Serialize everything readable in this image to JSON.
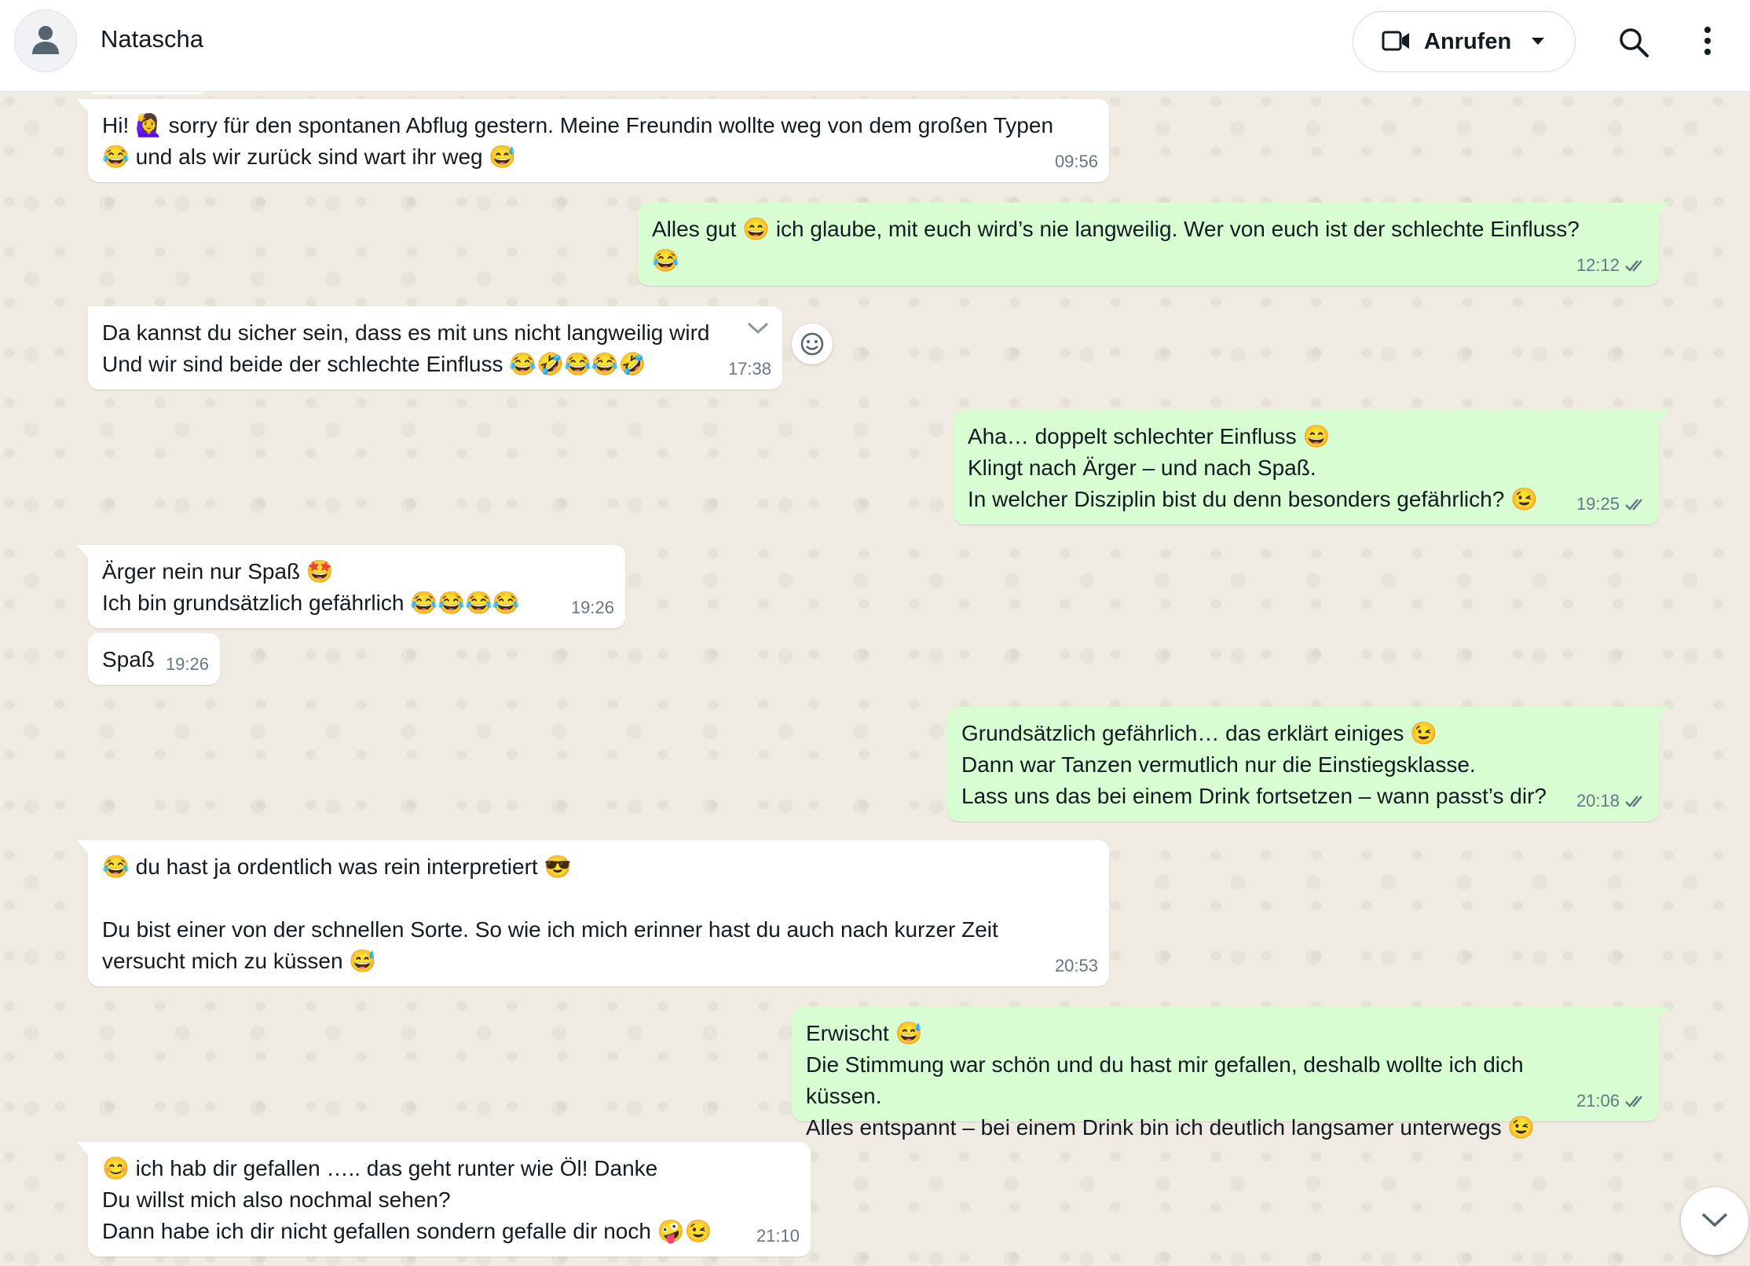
{
  "header": {
    "contact_name": "Natascha",
    "call_label": "Anrufen"
  },
  "messages": [
    {
      "direction": "in",
      "text": "Hi! 🙋‍♀️ sorry für den spontanen Abflug gestern. Meine Freundin wollte weg von dem großen Typen\n😂 und als wir zurück sind wart ihr weg 😅",
      "time": "09:56"
    },
    {
      "direction": "out",
      "text": "Alles gut 😄 ich glaube, mit euch wird’s nie langweilig. Wer von euch ist der schlechte Einfluss?\n😂",
      "time": "12:12"
    },
    {
      "direction": "in",
      "text": "Da kannst du sicher sein, dass es mit uns nicht langweilig wird\nUnd wir sind beide der schlechte Einfluss 😂🤣😂😂🤣",
      "time": "17:38"
    },
    {
      "direction": "out",
      "text": "Aha… doppelt schlechter Einfluss 😄\nKlingt nach Ärger – und nach Spaß.\nIn welcher Disziplin bist du denn besonders gefährlich? 😉",
      "time": "19:25"
    },
    {
      "direction": "in",
      "text": "Ärger nein nur Spaß 🤩\nIch bin grundsätzlich gefährlich 😂😂😂😂",
      "time": "19:26"
    },
    {
      "direction": "in",
      "text": "Spaß",
      "time": "19:26"
    },
    {
      "direction": "out",
      "text": "Grundsätzlich gefährlich… das erklärt einiges 😉\nDann war Tanzen vermutlich nur die Einstiegsklasse.\nLass uns das bei einem Drink fortsetzen – wann passt’s dir?",
      "time": "20:18"
    },
    {
      "direction": "in",
      "text": "😂 du hast ja ordentlich was rein interpretiert 😎\n\nDu bist einer von der schnellen Sorte. So wie ich mich erinner hast du auch nach kurzer Zeit\nversucht mich zu küssen 😅",
      "time": "20:53"
    },
    {
      "direction": "out",
      "text": "Erwischt 😅\nDie Stimmung war schön und du hast mir gefallen, deshalb wollte ich dich küssen.\nAlles entspannt – bei einem Drink bin ich deutlich langsamer unterwegs 😉",
      "time": "21:06"
    },
    {
      "direction": "in",
      "text": "😊 ich hab dir gefallen ….. das geht runter wie Öl! Danke\nDu willst mich also nochmal sehen?\nDann habe ich dir nicht gefallen sondern gefalle dir noch 🤪😉",
      "time": "21:10"
    }
  ]
}
